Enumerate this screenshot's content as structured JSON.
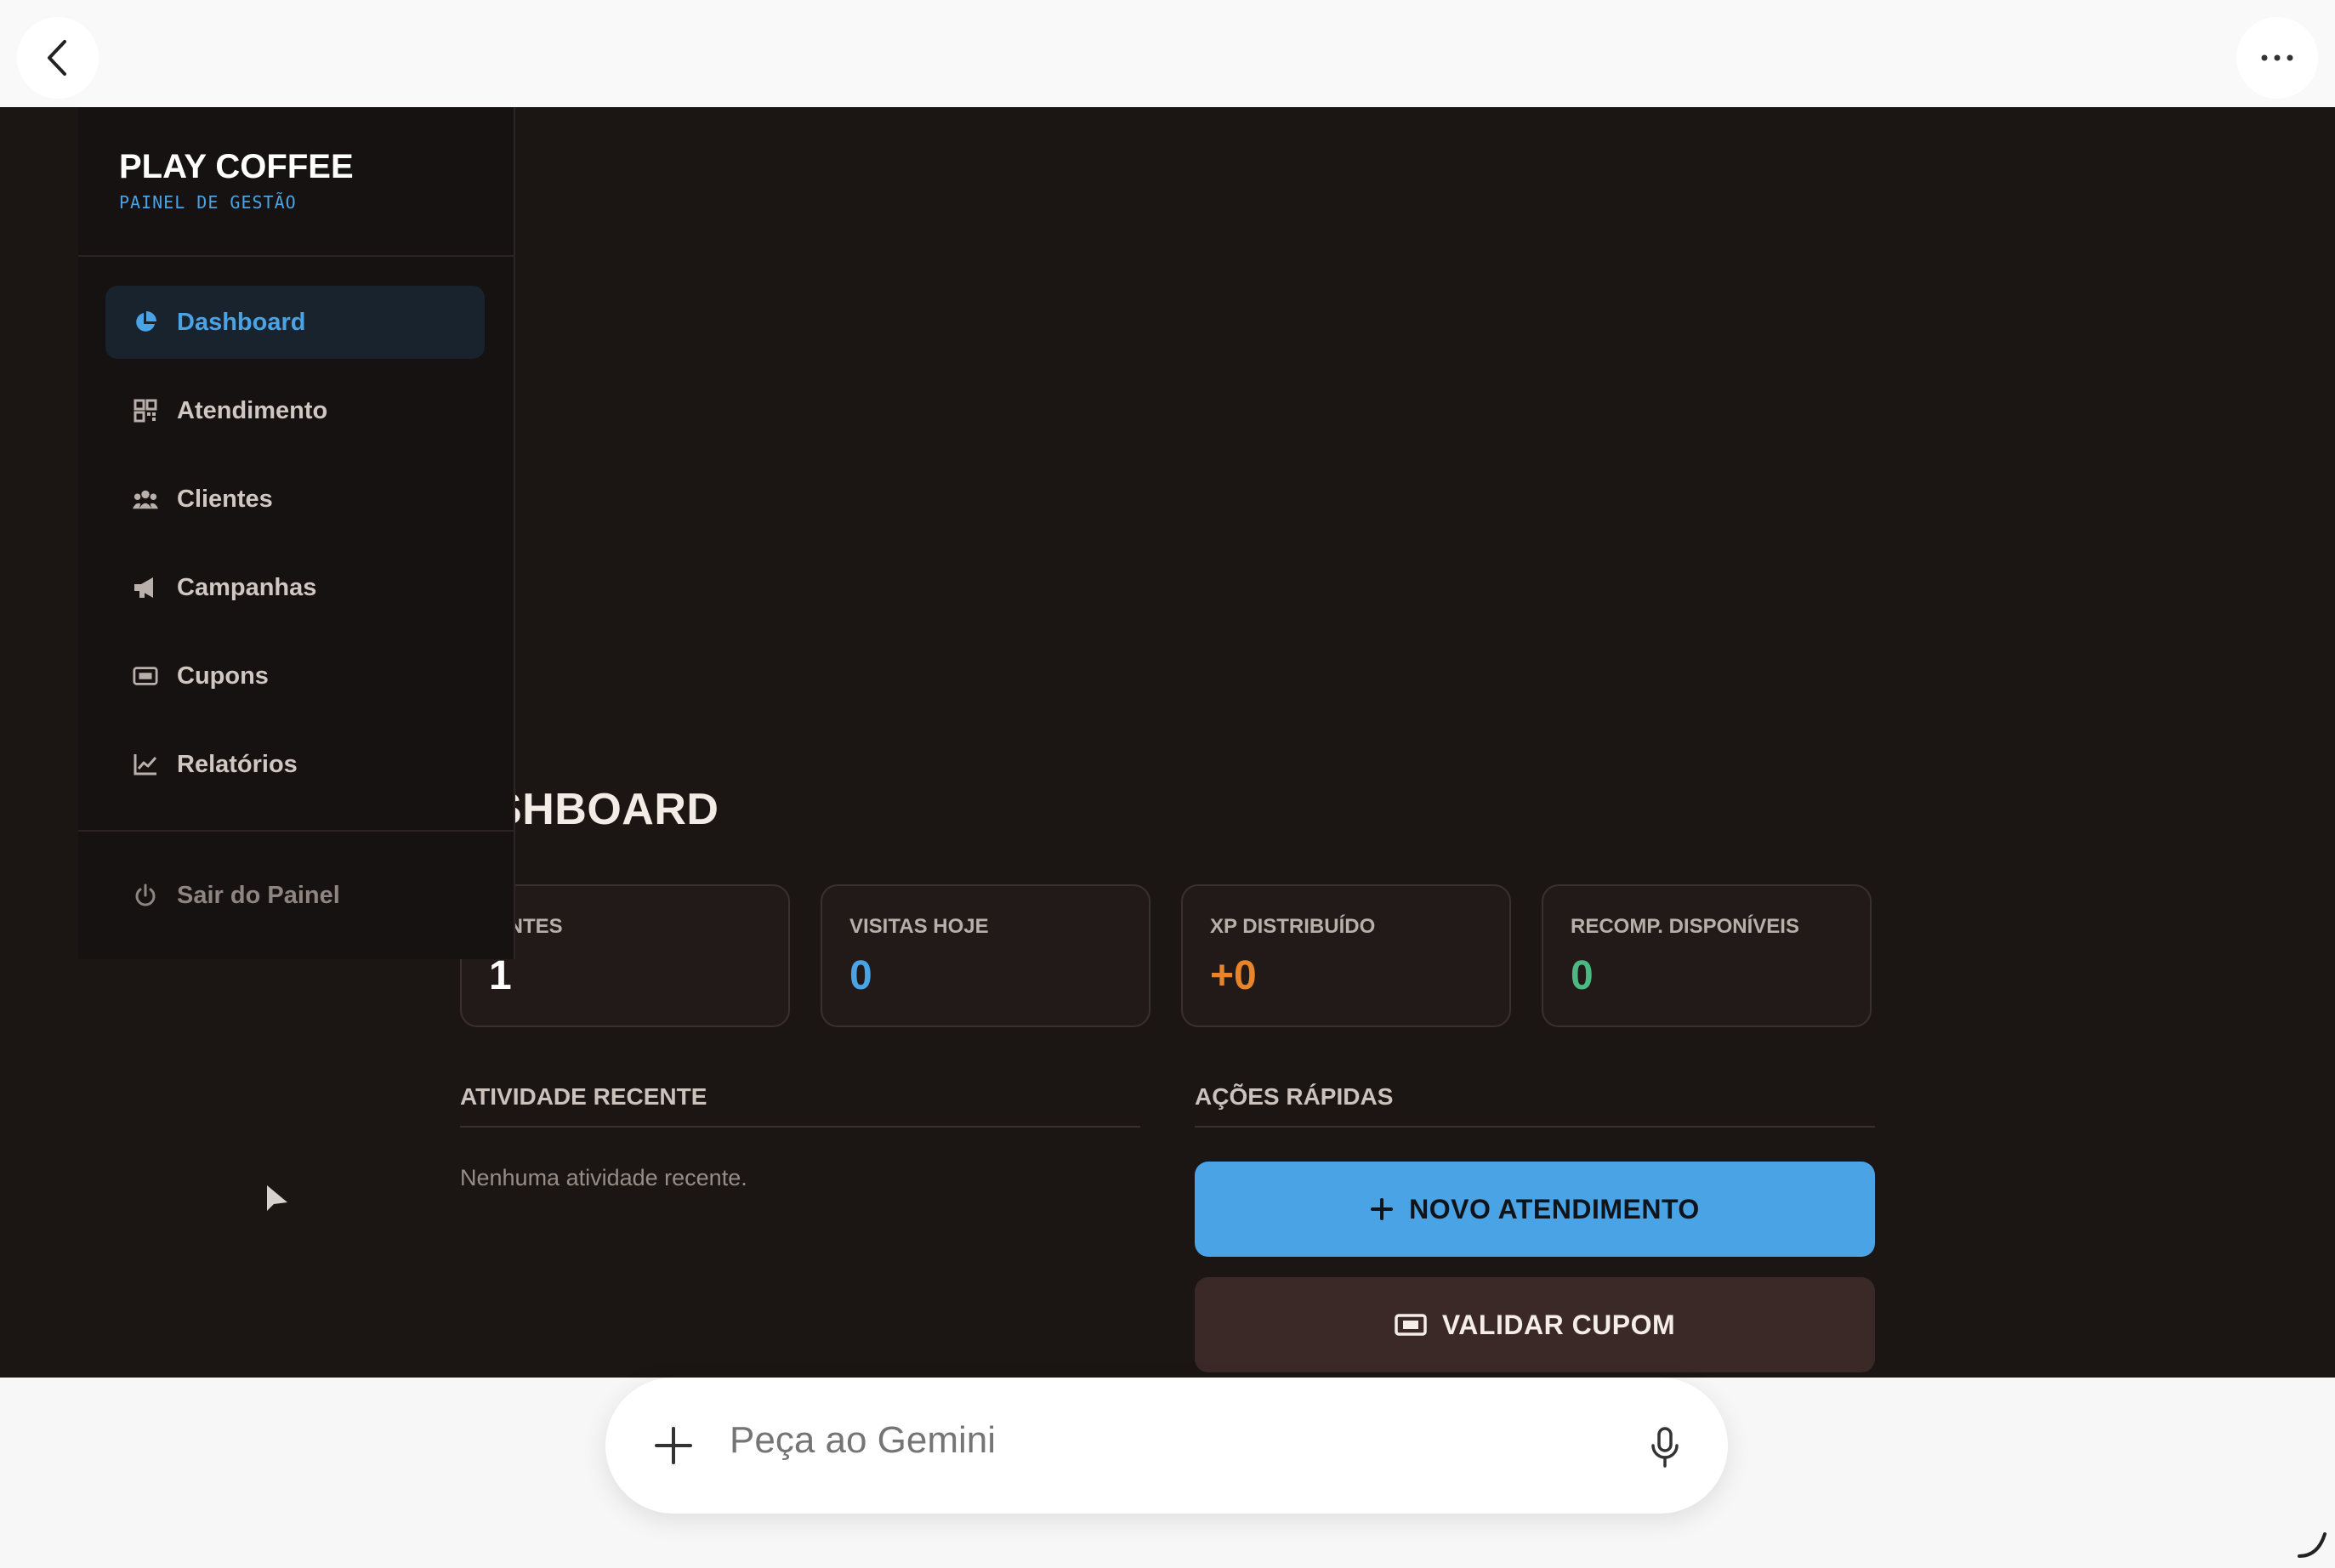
{
  "browser": {
    "back_icon": "back-arrow-icon",
    "more_icon": "more-options-icon"
  },
  "sidebar": {
    "brand": "PLAY COFFEE",
    "subtitle": "PAINEL DE GESTÃO",
    "items": [
      {
        "label": "Dashboard",
        "icon": "pie-chart-icon",
        "active": true
      },
      {
        "label": "Atendimento",
        "icon": "qr-code-icon",
        "active": false
      },
      {
        "label": "Clientes",
        "icon": "users-icon",
        "active": false
      },
      {
        "label": "Campanhas",
        "icon": "megaphone-icon",
        "active": false
      },
      {
        "label": "Cupons",
        "icon": "ticket-icon",
        "active": false
      },
      {
        "label": "Relatórios",
        "icon": "line-chart-icon",
        "active": false
      }
    ],
    "logout": {
      "label": "Sair do Painel",
      "icon": "power-icon"
    }
  },
  "main": {
    "title": "ASHBOARD",
    "stats": [
      {
        "label": "IENTES",
        "value": "1",
        "color": "#ffffff"
      },
      {
        "label": "VISITAS HOJE",
        "value": "0",
        "color": "#4aa3e5"
      },
      {
        "label": "XP DISTRIBUÍDO",
        "value": "+0",
        "color": "#e8852a"
      },
      {
        "label": "RECOMP. DISPONÍVEIS",
        "value": "0",
        "color": "#4cb882"
      }
    ],
    "recent_activity": {
      "title": "ATIVIDADE RECENTE",
      "empty": "Nenhuma atividade recente."
    },
    "quick_actions": {
      "title": "AÇÕES RÁPIDAS",
      "primary": {
        "label": "NOVO ATENDIMENTO",
        "icon": "plus-icon"
      },
      "secondary": {
        "label": "VALIDAR CUPOM",
        "icon": "ticket-icon"
      }
    }
  },
  "gemini": {
    "placeholder": "Peça ao Gemini",
    "add_icon": "plus-icon",
    "mic_icon": "microphone-icon"
  },
  "colors": {
    "accent": "#4aa3e5",
    "background": "#1b1513",
    "sidebar": "#151211",
    "secondary_button": "#3a2927"
  }
}
